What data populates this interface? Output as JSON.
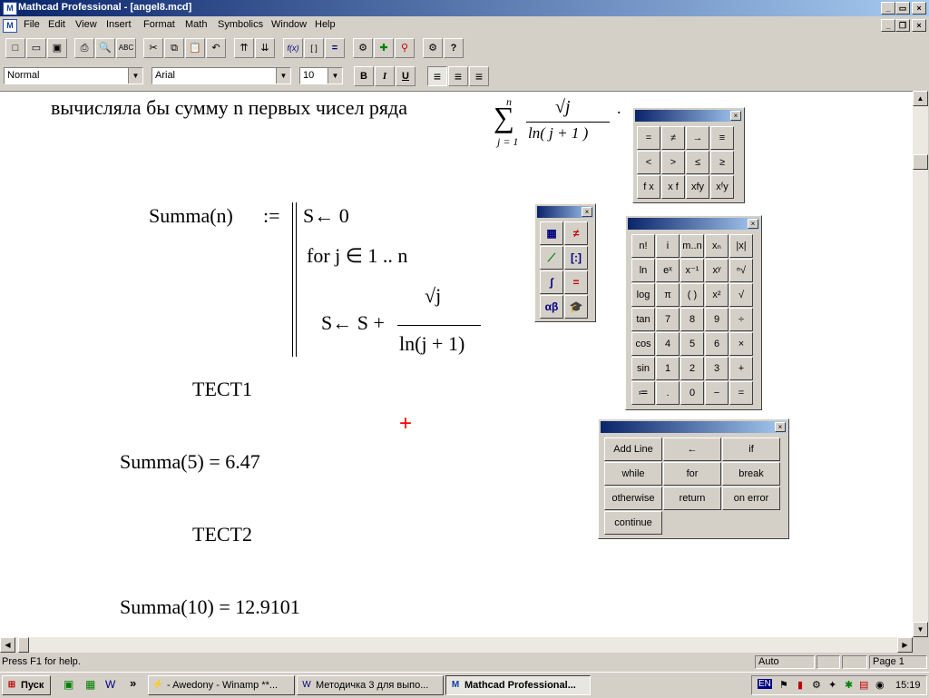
{
  "window": {
    "title": "Mathcad Professional - [angel8.mcd]",
    "icon_label": "M",
    "min_symbol": "_",
    "max_symbol": "▭",
    "close_symbol": "×",
    "restore_symbol": "❐"
  },
  "menu": [
    "File",
    "Edit",
    "View",
    "Insert",
    "Format",
    "Math",
    "Symbolics",
    "Window",
    "Help"
  ],
  "toolbar": {
    "icons": [
      "new-icon",
      "open-icon",
      "save-icon",
      "print-icon",
      "print-preview-icon",
      "spell-check-icon",
      "cut-icon",
      "copy-icon",
      "paste-icon",
      "undo-icon",
      "align-across-icon",
      "align-down-icon",
      "insert-function-icon",
      "insert-unit-icon",
      "calculate-icon",
      "component-icon",
      "resource-icon",
      "graph-icon",
      "help-icon"
    ],
    "glyphs": [
      "□",
      "▭",
      "▣",
      "⎙",
      "🔍",
      "ABC",
      "✂",
      "⧉",
      "📋",
      "↶",
      "⇈",
      "⇊",
      "f(x)",
      "[ ]",
      "=",
      "⚙",
      "✚",
      "⚲",
      "?"
    ]
  },
  "format": {
    "style": "Normal",
    "font": "Arial",
    "size": "10",
    "bold": "B",
    "italic": "I",
    "underline": "U",
    "align_left_symbol": "≡",
    "align_center_symbol": "≡",
    "align_right_symbol": "≡"
  },
  "document": {
    "text_line": "вычисляла бы сумму n первых чисел ряда",
    "sum_upper": "n",
    "sum_symbol": "∑",
    "sum_lower": "j = 1",
    "sqrt_j": "√j",
    "denominator": "ln(  j + 1 )",
    "period": ".",
    "def_lhs": "Summa(n)",
    "def_op": ":=",
    "line1": "S← 0",
    "line2": "for  j ∈  1 .. n",
    "line3_left": "S← S +",
    "line3_num": "√j",
    "line3_den": "ln(j + 1)",
    "test1": "ТЕСТ1",
    "result1": "Summa(5)  =  6.47",
    "test2": "ТЕСТ2",
    "result2": "Summa(10)  =  12.9101",
    "cursor": "+"
  },
  "palettes": {
    "close_symbol": "×",
    "boolean": [
      "=",
      "≠",
      "→",
      "≡",
      "<",
      ">",
      "≤",
      "≥",
      "f x",
      "x f",
      "xfy",
      "xᶠy"
    ],
    "math_toolbar_icons": [
      "calculator-icon",
      "boolean-icon",
      "graph-icon",
      "matrix-icon",
      "calculus-icon",
      "evaluation-icon",
      "greek-icon",
      "programming-icon"
    ],
    "math_toolbar_glyphs": [
      "▦",
      "≠",
      "⟋",
      "[:]",
      "∫",
      "=",
      "αβ",
      "🎓"
    ],
    "calculator": [
      "n!",
      "i",
      "m..n",
      "xₙ",
      "|x|",
      "ln",
      "eˣ",
      "x⁻¹",
      "xʸ",
      "ⁿ√",
      "log",
      "π",
      "( )",
      "x²",
      "√",
      "tan",
      "7",
      "8",
      "9",
      "÷",
      "cos",
      "4",
      "5",
      "6",
      "×",
      "sin",
      "1",
      "2",
      "3",
      "+",
      "≔",
      ".",
      "0",
      "−",
      "="
    ],
    "programming": [
      "Add Line",
      "←",
      "if",
      "while",
      "for",
      "break",
      "otherwise",
      "return",
      "on error",
      "continue"
    ]
  },
  "status": {
    "help": "Press F1 for help.",
    "mode": "Auto",
    "page": "Page 1"
  },
  "taskbar": {
    "start": "Пуск",
    "more": "»",
    "tasks": [
      "- Awedony - Winamp **...",
      "Методичка 3 для выпо...",
      "Mathcad Professional..."
    ],
    "tray_lang": "EN",
    "clock": "15:19"
  },
  "colors": {
    "title_dark": "#0a246a",
    "title_light": "#a6caf0",
    "face": "#d4d0c8",
    "cursor": "#ff0000"
  }
}
